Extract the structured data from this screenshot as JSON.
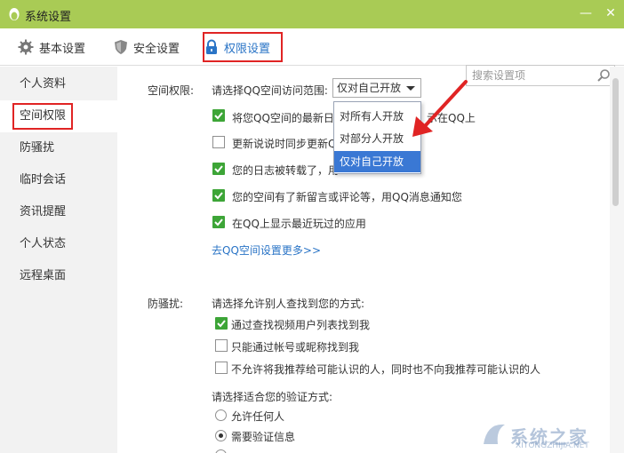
{
  "window": {
    "title": "系统设置",
    "minimize_glyph": "—",
    "close_glyph": "✕"
  },
  "toolbar": {
    "tabs": [
      {
        "label": "基本设置",
        "icon": "gear-icon"
      },
      {
        "label": "安全设置",
        "icon": "shield-icon"
      },
      {
        "label": "权限设置",
        "icon": "lock-icon",
        "active": true
      }
    ],
    "search_placeholder": "搜索设置项"
  },
  "sidebar": {
    "items": [
      {
        "label": "个人资料"
      },
      {
        "label": "空间权限",
        "active": true
      },
      {
        "label": "防骚扰"
      },
      {
        "label": "临时会话"
      },
      {
        "label": "资讯提醒"
      },
      {
        "label": "个人状态"
      },
      {
        "label": "远程桌面"
      }
    ]
  },
  "space_section": {
    "label": "空间权限:",
    "scope_prompt": "请选择QQ空间访问范围:",
    "scope_selected": "仅对自己开放",
    "scope_options": [
      "对所有人开放",
      "对部分人开放",
      "仅对自己开放"
    ],
    "options": [
      {
        "text_left": "将您QQ空间的最新日",
        "text_right": "示在QQ上",
        "checked": true
      },
      {
        "text_left": "更新说说时同步更新Q",
        "checked": false
      },
      {
        "text_left": "您的日志被转载了，用",
        "checked": true
      },
      {
        "text": "您的空间有了新留言或评论等，用QQ消息通知您",
        "checked": true
      },
      {
        "text": "在QQ上显示最近玩过的应用",
        "checked": true
      }
    ],
    "more_link": "去QQ空间设置更多>>"
  },
  "harass_section": {
    "label": "防骚扰:",
    "find_prompt": "请选择允许别人查找到您的方式:",
    "find_options": [
      {
        "text": "通过查找视频用户列表找到我",
        "checked": true
      },
      {
        "text": "只能通过帐号或昵称找到我",
        "checked": false
      },
      {
        "text": "不允许将我推荐给可能认识的人，同时也不向我推荐可能认识的人",
        "checked": false
      }
    ],
    "verify_prompt": "请选择适合您的验证方式:",
    "verify_options": [
      {
        "text": "允许任何人",
        "checked": false
      },
      {
        "text": "需要验证信息",
        "checked": true
      }
    ]
  },
  "watermark": {
    "text": "系统之家",
    "url": "XITONGZHIJIA.NET"
  },
  "colors": {
    "titlebar": "#a9cb55",
    "accent": "#2a74c6",
    "checkbox": "#3da537",
    "highlight": "#e02424",
    "dropdown_selected": "#3a78d4"
  }
}
